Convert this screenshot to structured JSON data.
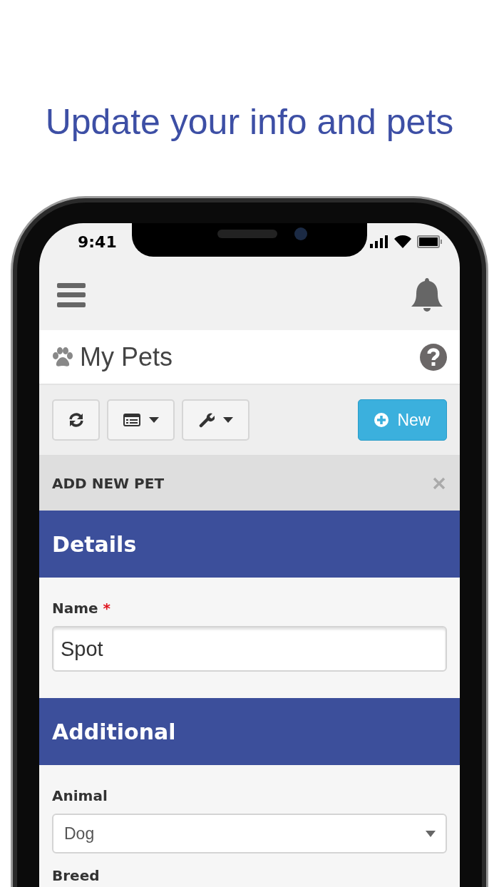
{
  "headline": "Update your info and pets",
  "status_bar": {
    "time": "9:41"
  },
  "page": {
    "title": "My Pets"
  },
  "toolbar": {
    "buttons": [
      {
        "kind": "refresh"
      },
      {
        "kind": "list-menu"
      },
      {
        "kind": "tools-menu"
      }
    ],
    "new_button": "New"
  },
  "panel": {
    "title": "ADD NEW PET",
    "sections": [
      {
        "title": "Details",
        "fields": [
          {
            "kind": "text",
            "label": "Name",
            "required_mark": "*",
            "value": "Spot"
          }
        ]
      },
      {
        "title": "Additional",
        "fields": [
          {
            "kind": "select",
            "label": "Animal",
            "value": "Dog"
          },
          {
            "label": "Breed"
          }
        ]
      }
    ]
  }
}
